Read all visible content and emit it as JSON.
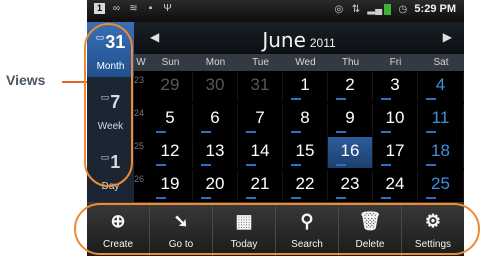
{
  "callout": {
    "label": "Views"
  },
  "status_bar": {
    "time": "5:29 PM"
  },
  "header": {
    "month": "June",
    "year": "2011"
  },
  "views": [
    {
      "number": "31",
      "label": "Month",
      "active": true
    },
    {
      "number": "7",
      "label": "Week",
      "active": false
    },
    {
      "number": "1",
      "label": "Day",
      "active": false
    }
  ],
  "weekdays": [
    "W",
    "Sun",
    "Mon",
    "Tue",
    "Wed",
    "Thu",
    "Fri",
    "Sat"
  ],
  "weeks": [
    {
      "week": "23",
      "days": [
        "29",
        "30",
        "31",
        "1",
        "2",
        "3",
        "4"
      ]
    },
    {
      "week": "24",
      "days": [
        "5",
        "6",
        "7",
        "8",
        "9",
        "10",
        "11"
      ]
    },
    {
      "week": "25",
      "days": [
        "12",
        "13",
        "14",
        "15",
        "16",
        "17",
        "18"
      ]
    },
    {
      "week": "26",
      "days": [
        "19",
        "20",
        "21",
        "22",
        "23",
        "24",
        "25"
      ]
    }
  ],
  "today": "16",
  "toolbar": [
    {
      "label": "Create",
      "icon": "plus-circle-icon"
    },
    {
      "label": "Go to",
      "icon": "pointer-icon"
    },
    {
      "label": "Today",
      "icon": "calendar-grid-icon"
    },
    {
      "label": "Search",
      "icon": "magnifier-icon"
    },
    {
      "label": "Delete",
      "icon": "trash-icon"
    },
    {
      "label": "Settings",
      "icon": "gear-icon"
    }
  ],
  "colors": {
    "accent": "#ef8a33",
    "weekend": "#3f8ee0",
    "active_view": "#2f63a6"
  }
}
